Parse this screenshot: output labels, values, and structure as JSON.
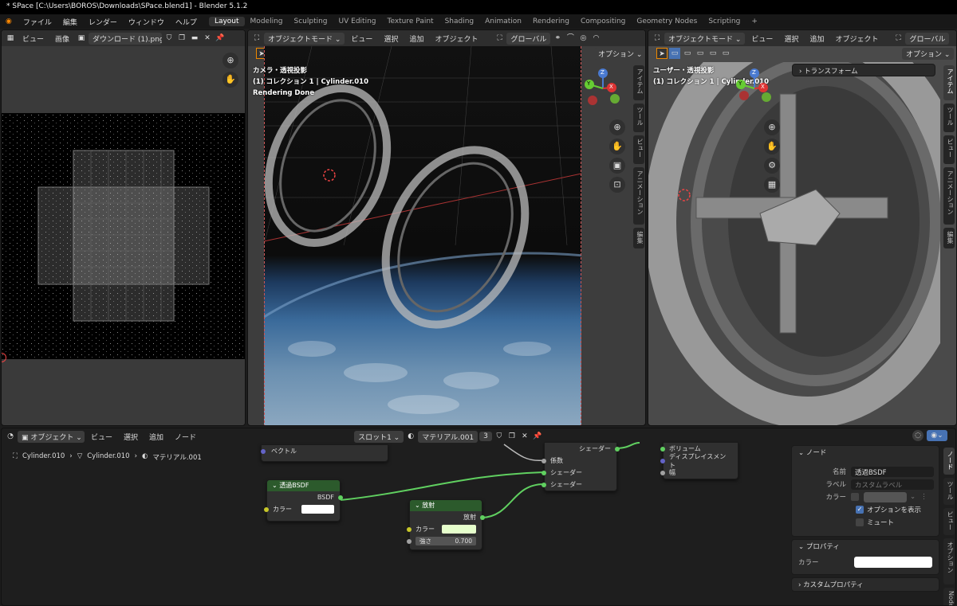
{
  "window": {
    "title": "* SPace [C:\\Users\\BOROS\\Downloads\\SPace.blend1] - Blender 5.1.2"
  },
  "menu": [
    "ファイル",
    "編集",
    "レンダー",
    "ウィンドウ",
    "ヘルプ"
  ],
  "workspaces": [
    "Layout",
    "Modeling",
    "Sculpting",
    "UV Editing",
    "Texture Paint",
    "Shading",
    "Animation",
    "Rendering",
    "Compositing",
    "Geometry Nodes",
    "Scripting"
  ],
  "workspace_add": "+",
  "image_editor": {
    "menu_view": "ビュー",
    "menu_image": "画像",
    "image_name": "ダウンロード (1).png"
  },
  "viewport_cam": {
    "mode": "オブジェクトモード",
    "menu": [
      "ビュー",
      "選択",
      "追加",
      "オブジェクト"
    ],
    "orientation": "グローバル",
    "options": "オプション",
    "overlay_lines": [
      "カメラ・透視投影",
      "(1) コレクション 1 | Cylinder.010",
      "Rendering Done"
    ],
    "side_tabs": [
      "アイテム",
      "ツール",
      "ビュー",
      "アニメーション",
      "編集"
    ]
  },
  "viewport_user": {
    "mode": "オブジェクトモード",
    "menu": [
      "ビュー",
      "選択",
      "追加",
      "オブジェクト"
    ],
    "orientation": "グローバル",
    "options": "オプション",
    "overlay_lines": [
      "ユーザー・透視投影",
      "(1) コレクション 1 | Cylinder.010"
    ],
    "transform_panel": "トランスフォーム",
    "side_tabs": [
      "アイテム",
      "ツール",
      "ビュー",
      "アニメーション",
      "編集"
    ]
  },
  "gizmo": {
    "x": "X",
    "y": "Y",
    "z": "Z"
  },
  "node_editor": {
    "object_type": "オブジェクト",
    "menu": [
      "ビュー",
      "選択",
      "追加",
      "ノード"
    ],
    "slot": "スロット1",
    "material": "マテリアル.001",
    "users": "3",
    "breadcrumb": [
      "Cylinder.010",
      "Cylinder.010",
      "マテリアル.001"
    ]
  },
  "nodes": {
    "vector_row": "ベクトル",
    "transparent": {
      "title": "透過BSDF",
      "output": "BSDF",
      "color_label": "カラー",
      "color": "#ffffff"
    },
    "emission": {
      "title": "放射",
      "output": "放射",
      "color_label": "カラー",
      "color": "#e6ffcc",
      "strength_label": "強さ",
      "strength": "0.700"
    },
    "mix": {
      "output": "シェーダー",
      "fac": "係数",
      "in1": "シェーダー",
      "in2": "シェーダー"
    },
    "output": {
      "volume": "ボリューム",
      "displacement": "ディスプレイスメント",
      "thickness": "幅"
    }
  },
  "sidebar": {
    "node_panel": {
      "title": "ノード",
      "name_label": "名前",
      "name": "透過BSDF",
      "label_label": "ラベル",
      "label_placeholder": "カスタムラベル",
      "color_label": "カラー",
      "show_options": "オプションを表示",
      "mute": "ミュート"
    },
    "props_panel": {
      "title": "プロパティ",
      "color_label": "カラー"
    },
    "custom_panel": {
      "title": "カスタムプロパティ"
    },
    "tabs": [
      "ノード",
      "ツール",
      "ビュー",
      "オプション",
      "Node"
    ]
  },
  "colors": {
    "accent": "#4772b3",
    "node_green": "#2c5a2c",
    "link_green": "#60d060"
  }
}
